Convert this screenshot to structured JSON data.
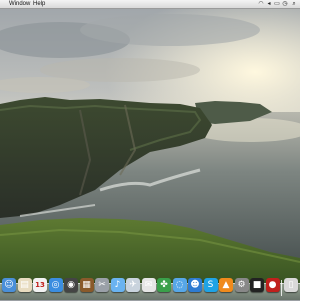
{
  "menubar": {
    "menus": [
      {
        "label": "Window"
      },
      {
        "label": "Help"
      }
    ],
    "status_icons": [
      "wifi-icon",
      "volume-icon",
      "battery-icon",
      "clock-icon",
      "spotlight-icon"
    ]
  },
  "desktop": {
    "wallpaper": "Coastal sea cliffs at sunset"
  },
  "dock": {
    "items": [
      {
        "icon": "finder-icon",
        "color": "#4a8fd9"
      },
      {
        "icon": "document-icon",
        "color": "#e8dcc0"
      },
      {
        "icon": "calendar-icon",
        "color": "#f2f2f2",
        "text": "13"
      },
      {
        "icon": "safari-icon",
        "color": "#3b8de0"
      },
      {
        "icon": "camera-icon",
        "color": "#444444"
      },
      {
        "icon": "iphoto-icon",
        "color": "#8a5a2b"
      },
      {
        "icon": "scissors-icon",
        "color": "#9aa0a8"
      },
      {
        "icon": "itunes-icon",
        "color": "#6ab3f0"
      },
      {
        "icon": "bird-icon",
        "color": "#c9d3dd"
      },
      {
        "icon": "mail-icon",
        "color": "#e6e6e6"
      },
      {
        "icon": "clover-icon",
        "color": "#3aa04a"
      },
      {
        "icon": "ichat-icon",
        "color": "#57a7e8"
      },
      {
        "icon": "person-icon",
        "color": "#2e7bd1"
      },
      {
        "icon": "skype-icon",
        "color": "#1fa3e6"
      },
      {
        "icon": "vlc-icon",
        "color": "#f08a1c"
      },
      {
        "icon": "system-preferences-icon",
        "color": "#888888"
      },
      {
        "icon": "camcorder-icon",
        "color": "#222222"
      },
      {
        "icon": "photo-booth-icon",
        "color": "#c0201c"
      },
      {
        "icon": "trash-icon",
        "color": "#d9d9d9"
      }
    ]
  }
}
